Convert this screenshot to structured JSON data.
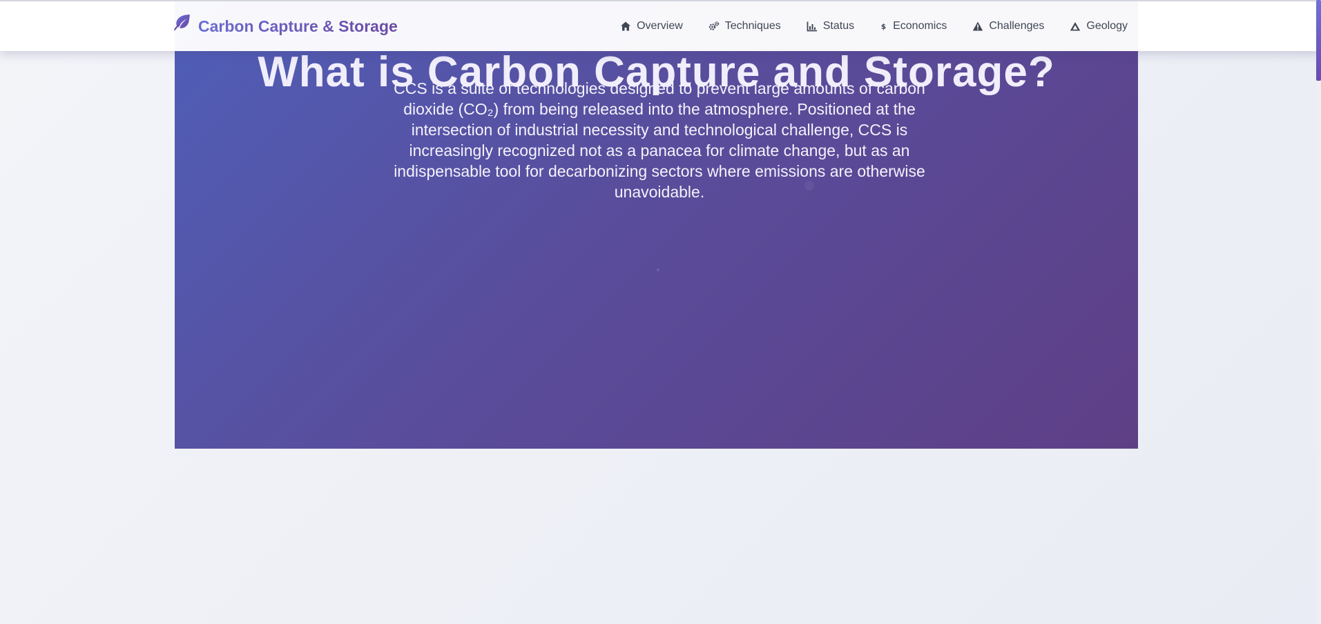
{
  "brand": {
    "title": "Carbon Capture & Storage",
    "icon": "leaf-icon"
  },
  "nav": {
    "items": [
      {
        "label": "Overview",
        "icon": "home-icon"
      },
      {
        "label": "Techniques",
        "icon": "cogs-icon"
      },
      {
        "label": "Status",
        "icon": "chart-icon"
      },
      {
        "label": "Economics",
        "icon": "dollar-icon"
      },
      {
        "label": "Challenges",
        "icon": "warning-icon"
      },
      {
        "label": "Geology",
        "icon": "mountain-icon"
      }
    ]
  },
  "hero": {
    "title": "What is Carbon Capture and Storage?",
    "text": "CCS is a suite of technologies designed to prevent large amounts of carbon dioxide (CO₂) from being released into the atmosphere. Positioned at the intersection of industrial necessity and technological challenge, CCS is increasingly recognized not as a panacea for climate change, but as an indispensable tool for decarbonizing sectors where emissions are otherwise unavoidable."
  },
  "colors": {
    "hero_start": "#4f5fb8",
    "hero_end": "#5e3f86",
    "brand": "#6a5ac4",
    "nav_text": "#3f4654"
  }
}
